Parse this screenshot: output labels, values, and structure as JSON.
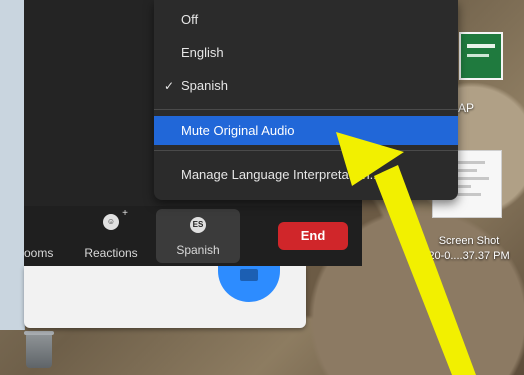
{
  "menu": {
    "items": [
      {
        "label": "Off",
        "checked": false
      },
      {
        "label": "English",
        "checked": false
      },
      {
        "label": "Spanish",
        "checked": true
      }
    ],
    "mute_original_audio": "Mute Original Audio",
    "manage_language": "Manage Language Interpretation..."
  },
  "toolbar": {
    "rooms_label": "ooms",
    "reactions_label": "Reactions",
    "spanish_label": "Spanish",
    "spanish_icon_text": "ES",
    "end_label": "End"
  },
  "desktop": {
    "label_top": "AP",
    "file_caption_line1": "Screen Shot",
    "file_caption_line2": "20-0....37.37 PM"
  },
  "colors": {
    "menu_highlight": "#2167d8",
    "end_button": "#d0262a",
    "arrow": "#f2f000"
  },
  "icons": {
    "check": "check-icon",
    "reactions": "smiley-plus-icon",
    "interpretation": "globe-es-icon",
    "trash": "trash-icon"
  }
}
